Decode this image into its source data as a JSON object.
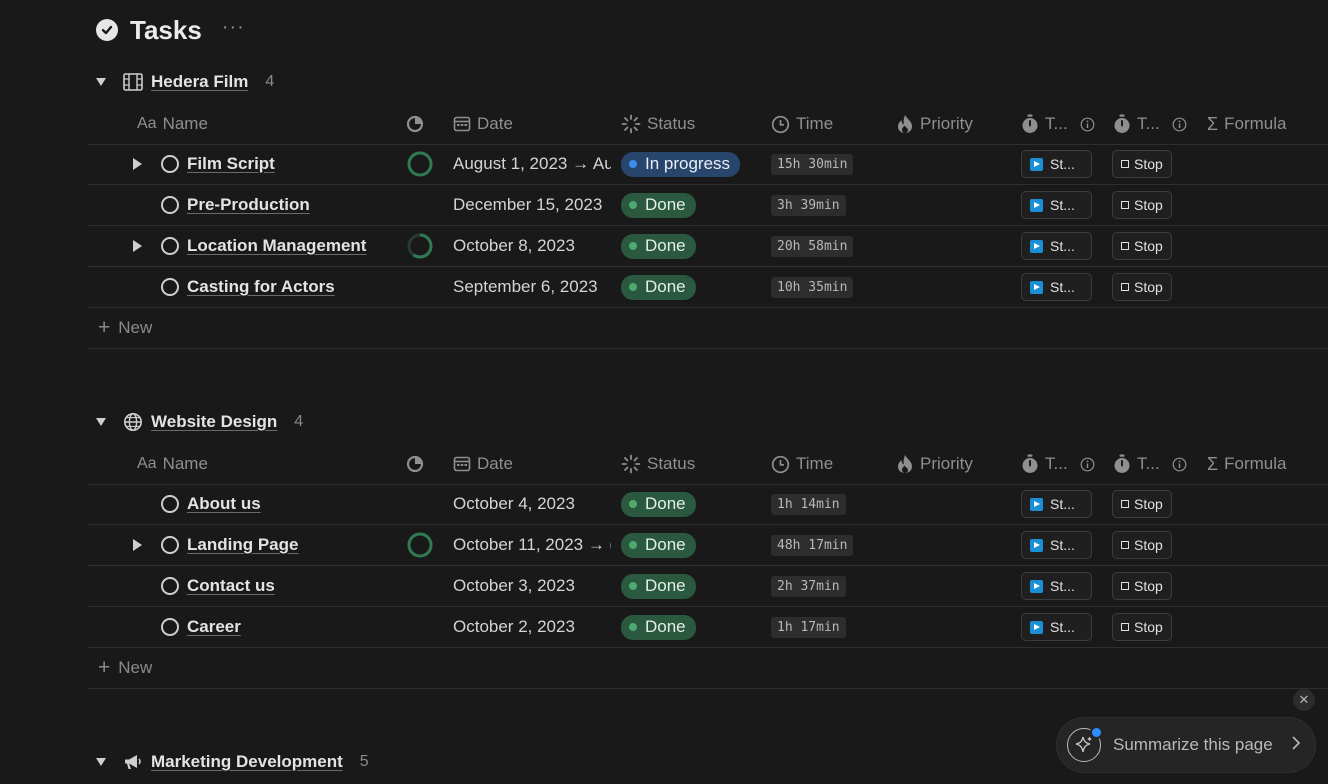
{
  "page": {
    "title": "Tasks",
    "more": "···"
  },
  "columns": {
    "name": "Name",
    "date": "Date",
    "status": "Status",
    "time": "Time",
    "priority": "Priority",
    "t1": "T...",
    "t2": "T...",
    "formula": "Formula"
  },
  "groups": [
    {
      "name": "Hedera Film",
      "count": "4",
      "icon": "film-icon",
      "rows": [
        {
          "name": "Film Script",
          "expandable": true,
          "progress": 1.0,
          "date": "August 1, 2023 → Au",
          "status": "In progress",
          "status_kind": "progress",
          "time": "15h 30min",
          "start": "St...",
          "stop": "Stop"
        },
        {
          "name": "Pre-Production",
          "expandable": false,
          "progress": null,
          "date": "December 15, 2023",
          "status": "Done",
          "status_kind": "done",
          "time": "3h 39min",
          "start": "St...",
          "stop": "Stop"
        },
        {
          "name": "Location Management",
          "expandable": true,
          "progress": 0.6,
          "date": "October 8, 2023",
          "status": "Done",
          "status_kind": "done",
          "time": "20h 58min",
          "start": "St...",
          "stop": "Stop"
        },
        {
          "name": "Casting for Actors",
          "expandable": false,
          "progress": null,
          "date": "September 6, 2023",
          "status": "Done",
          "status_kind": "done",
          "time": "10h 35min",
          "start": "St...",
          "stop": "Stop"
        }
      ],
      "new_label": "New"
    },
    {
      "name": "Website Design",
      "count": "4",
      "icon": "globe-icon",
      "rows": [
        {
          "name": "About us",
          "expandable": false,
          "progress": null,
          "date": "October 4, 2023",
          "status": "Done",
          "status_kind": "done",
          "time": "1h 14min",
          "start": "St...",
          "stop": "Stop"
        },
        {
          "name": "Landing Page",
          "expandable": true,
          "progress": 1.0,
          "date": "October 11, 2023 → (",
          "status": "Done",
          "status_kind": "done",
          "time": "48h 17min",
          "start": "St...",
          "stop": "Stop"
        },
        {
          "name": "Contact us",
          "expandable": false,
          "progress": null,
          "date": "October 3, 2023",
          "status": "Done",
          "status_kind": "done",
          "time": "2h 37min",
          "start": "St...",
          "stop": "Stop"
        },
        {
          "name": "Career",
          "expandable": false,
          "progress": null,
          "date": "October 2, 2023",
          "status": "Done",
          "status_kind": "done",
          "time": "1h 17min",
          "start": "St...",
          "stop": "Stop"
        }
      ],
      "new_label": "New"
    },
    {
      "name": "Marketing Development",
      "count": "5",
      "icon": "megaphone-icon"
    }
  ],
  "summarize": {
    "label": "Summarize this page",
    "close": "✕"
  },
  "colors": {
    "background": "#191919",
    "done": "#2b593f",
    "in_progress": "#28456c",
    "progress_ring": "#2f7a52"
  }
}
